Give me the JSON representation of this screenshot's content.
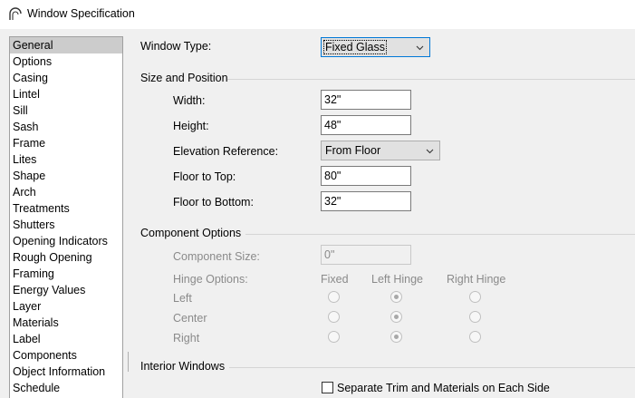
{
  "window": {
    "title": "Window Specification",
    "icon": "arch-window-icon"
  },
  "sidebar": {
    "items": [
      {
        "label": "General",
        "selected": true
      },
      {
        "label": "Options"
      },
      {
        "label": "Casing"
      },
      {
        "label": "Lintel"
      },
      {
        "label": "Sill"
      },
      {
        "label": "Sash"
      },
      {
        "label": "Frame"
      },
      {
        "label": "Lites"
      },
      {
        "label": "Shape"
      },
      {
        "label": "Arch"
      },
      {
        "label": "Treatments"
      },
      {
        "label": "Shutters"
      },
      {
        "label": "Opening Indicators"
      },
      {
        "label": "Rough Opening"
      },
      {
        "label": "Framing"
      },
      {
        "label": "Energy Values"
      },
      {
        "label": "Layer"
      },
      {
        "label": "Materials"
      },
      {
        "label": "Label"
      },
      {
        "label": "Components"
      },
      {
        "label": "Object Information"
      },
      {
        "label": "Schedule"
      }
    ]
  },
  "general": {
    "window_type": {
      "label": "Window Type:",
      "value": "Fixed Glass"
    },
    "size_position": {
      "title": "Size and Position",
      "width": {
        "label": "Width:",
        "value": "32\""
      },
      "height": {
        "label": "Height:",
        "value": "48\""
      },
      "elevation_reference": {
        "label": "Elevation Reference:",
        "value": "From Floor"
      },
      "floor_to_top": {
        "label": "Floor to Top:",
        "value": "80\""
      },
      "floor_to_bottom": {
        "label": "Floor to Bottom:",
        "value": "32\""
      }
    },
    "component_options": {
      "title": "Component Options",
      "component_size": {
        "label": "Component Size:",
        "value": "0\""
      },
      "hinge_options": {
        "label": "Hinge Options:",
        "columns": [
          "Fixed",
          "Left Hinge",
          "Right Hinge"
        ],
        "rows": [
          {
            "label": "Left",
            "selected": "Left Hinge"
          },
          {
            "label": "Center",
            "selected": "Left Hinge"
          },
          {
            "label": "Right",
            "selected": "Left Hinge"
          }
        ]
      }
    },
    "interior_windows": {
      "title": "Interior Windows",
      "separate_trim": {
        "label": "Separate Trim and Materials on Each Side",
        "checked": false
      }
    }
  },
  "colors": {
    "selected_bg": "#cccccc",
    "focus_border": "#0078d7",
    "disabled_text": "#8a8a8a"
  }
}
